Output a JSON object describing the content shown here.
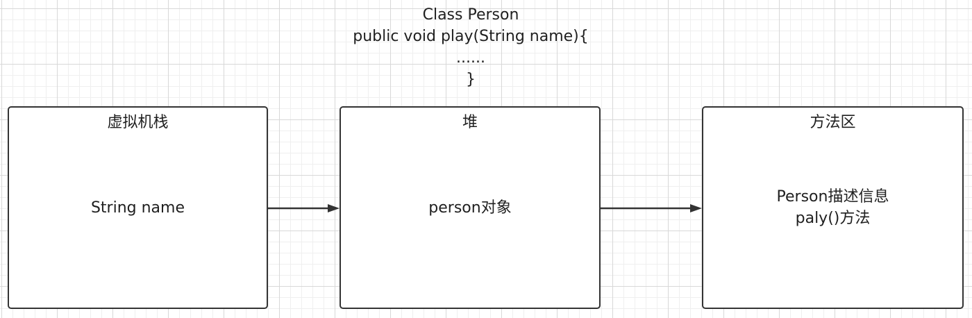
{
  "header": {
    "lines": [
      "Class Person",
      "public void play(String name){",
      "......",
      "}"
    ]
  },
  "boxes": {
    "stack": {
      "label": "虚拟机栈",
      "content": [
        "String name"
      ]
    },
    "heap": {
      "label": "堆",
      "content": [
        "person对象"
      ]
    },
    "method_area": {
      "label": "方法区",
      "content": [
        "Person描述信息",
        "paly()方法"
      ]
    }
  },
  "colors": {
    "border": "#333333",
    "arrow": "#333333",
    "grid": "#d8d8d8"
  }
}
